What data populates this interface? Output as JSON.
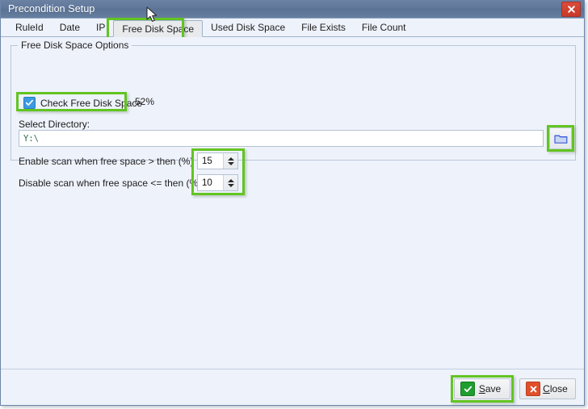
{
  "window": {
    "title": "Precondition Setup",
    "close_icon": "close-x-icon",
    "accent_highlight_color": "#63c422",
    "titlebar_color": "#61789b",
    "background_color": "#eef2fa"
  },
  "tabs": [
    {
      "label": "RuleId",
      "selected": false
    },
    {
      "label": "Date",
      "selected": false
    },
    {
      "label": "IP",
      "selected": false
    },
    {
      "label": "Free Disk Space",
      "selected": true
    },
    {
      "label": "Used Disk Space",
      "selected": false
    },
    {
      "label": "File Exists",
      "selected": false
    },
    {
      "label": "File Count",
      "selected": false
    }
  ],
  "groupbox": {
    "title": "Free Disk Space Options"
  },
  "check_free_disk_space": {
    "label": "Check Free Disk Space",
    "checked": true,
    "check_icon": "checkmark-icon"
  },
  "free_space_percent": "52%",
  "directory": {
    "label": "Select Directory:",
    "value": "Y:\\",
    "placeholder": "",
    "browse_icon": "folder-icon"
  },
  "thresholds": [
    {
      "label": "Enable scan when free space > then (%)",
      "value": "15",
      "up_icon": "chevron-up-icon",
      "down_icon": "chevron-down-icon"
    },
    {
      "label": "Disable scan when free space <= then (%)",
      "value": "10",
      "up_icon": "chevron-up-icon",
      "down_icon": "chevron-down-icon"
    }
  ],
  "footer": {
    "save": {
      "label_before": "",
      "accel": "S",
      "label_after": "ave",
      "icon": "green-check-icon"
    },
    "close": {
      "label_before": "",
      "accel": "C",
      "label_after": "lose",
      "icon": "red-x-icon"
    }
  },
  "cursor": {
    "icon": "mouse-pointer-icon"
  }
}
